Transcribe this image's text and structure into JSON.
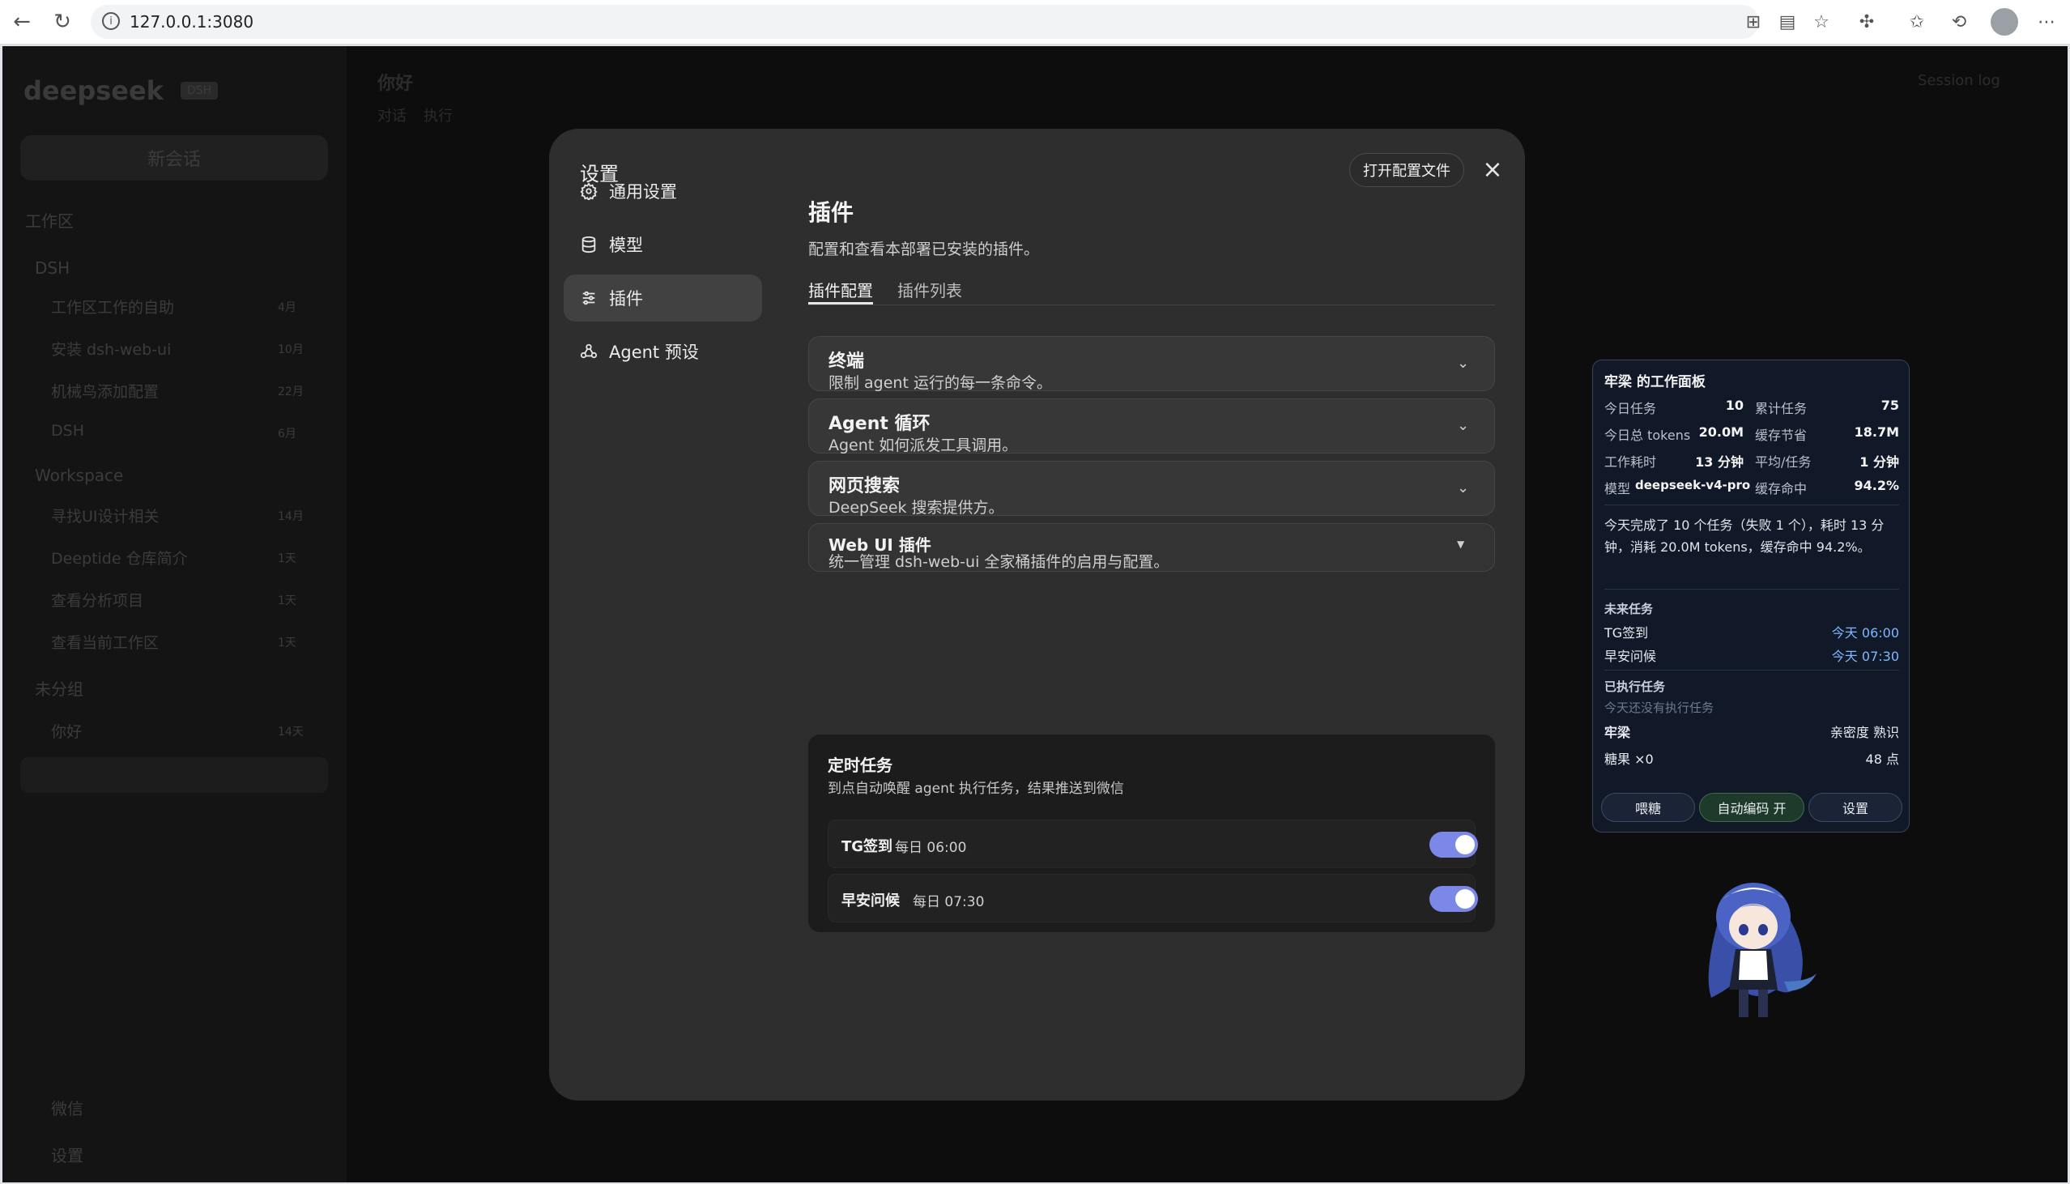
{
  "browser": {
    "url": "127.0.0.1:3080"
  },
  "app_bg": {
    "logo_text": "deepseek",
    "badge": "DSH",
    "new_chat": "新会话",
    "section_workspace": "工作区",
    "groups": [
      "DSH",
      "Workspace",
      "未分组"
    ],
    "items": [
      {
        "label": "工作区工作的自助",
        "meta": "4月"
      },
      {
        "label": "安装 dsh-web-ui",
        "meta": "10月"
      },
      {
        "label": "机械鸟添加配置",
        "meta": "22月"
      },
      {
        "label": "DSH",
        "meta": "6月"
      },
      {
        "label": "寻找UI设计相关",
        "meta": "14月"
      },
      {
        "label": "Deeptide 仓库简介",
        "meta": "1天"
      },
      {
        "label": "查看分析项目",
        "meta": "1天"
      },
      {
        "label": "查看当前工作区",
        "meta": "1天"
      },
      {
        "label": "你好",
        "meta": "14天"
      }
    ],
    "bottom_links": [
      "微信",
      "设置"
    ],
    "main_title": "你好",
    "main_tabs": [
      "对话",
      "执行"
    ],
    "session_log": "Session log"
  },
  "modal": {
    "title": "设置",
    "open_config": "打开配置文件",
    "close": "×",
    "nav": [
      {
        "label": "通用设置",
        "icon": "gear-icon",
        "active": false
      },
      {
        "label": "模型",
        "icon": "database-icon",
        "active": false
      },
      {
        "label": "插件",
        "icon": "sliders-icon",
        "active": true
      },
      {
        "label": "Agent 预设",
        "icon": "agent-icon",
        "active": false
      }
    ],
    "heading": "插件",
    "subtitle": "配置和查看本部署已安装的插件。",
    "tabs": [
      {
        "label": "插件配置",
        "active": true
      },
      {
        "label": "插件列表",
        "active": false
      }
    ],
    "cards": [
      {
        "title": "终端",
        "desc": "限制 agent 运行的每一条命令。"
      },
      {
        "title": "Agent 循环",
        "desc": "Agent 如何派发工具调用。"
      },
      {
        "title": "网页搜索",
        "desc": "DeepSeek 搜索提供方。"
      },
      {
        "title": "Web UI 插件",
        "desc": "统一管理 dsh-web-ui 全家桶插件的启用与配置。"
      }
    ],
    "schedule": {
      "title": "定时任务",
      "desc": "到点自动唤醒 agent 执行任务，结果推送到微信",
      "tasks": [
        {
          "name": "TG签到",
          "time": "每日 06:00",
          "enabled": true
        },
        {
          "name": "早安问候",
          "time": "每日 07:30",
          "enabled": true
        }
      ]
    }
  },
  "panel": {
    "title": "牢梁 的工作面板",
    "stats": [
      {
        "label": "今日任务",
        "value": "10"
      },
      {
        "label": "累计任务",
        "value": "75"
      },
      {
        "label": "今日总 tokens",
        "value": "20.0M"
      },
      {
        "label": "缓存节省",
        "value": "18.7M"
      },
      {
        "label": "工作耗时",
        "value": "13 分钟"
      },
      {
        "label": "平均/任务",
        "value": "1 分钟"
      },
      {
        "label": "模型",
        "value": "deepseek-v4-pro"
      },
      {
        "label": "缓存命中",
        "value": "94.2%"
      }
    ],
    "summary": "今天完成了 10 个任务（失败 1 个），耗时 13 分钟，消耗 20.0M tokens，缓存命中 94.2%。",
    "upcoming_title": "未来任务",
    "upcoming": [
      {
        "name": "TG签到",
        "time": "今天 06:00"
      },
      {
        "name": "早安问候",
        "time": "今天 07:30"
      }
    ],
    "executed_title": "已执行任务",
    "executed_empty": "今天还没有执行任务",
    "pet_name": "牢梁",
    "intimacy": "亲密度 熟识",
    "candy": "糖果 ×0",
    "points": "48 点",
    "buttons": [
      "喂糖",
      "自动编码 开",
      "设置"
    ]
  },
  "colors": {
    "modal_bg": "#2e2e2e",
    "toggle_on": "#7b88e8",
    "panel_bg": "#111827",
    "accent_time": "#7fb8ff"
  }
}
